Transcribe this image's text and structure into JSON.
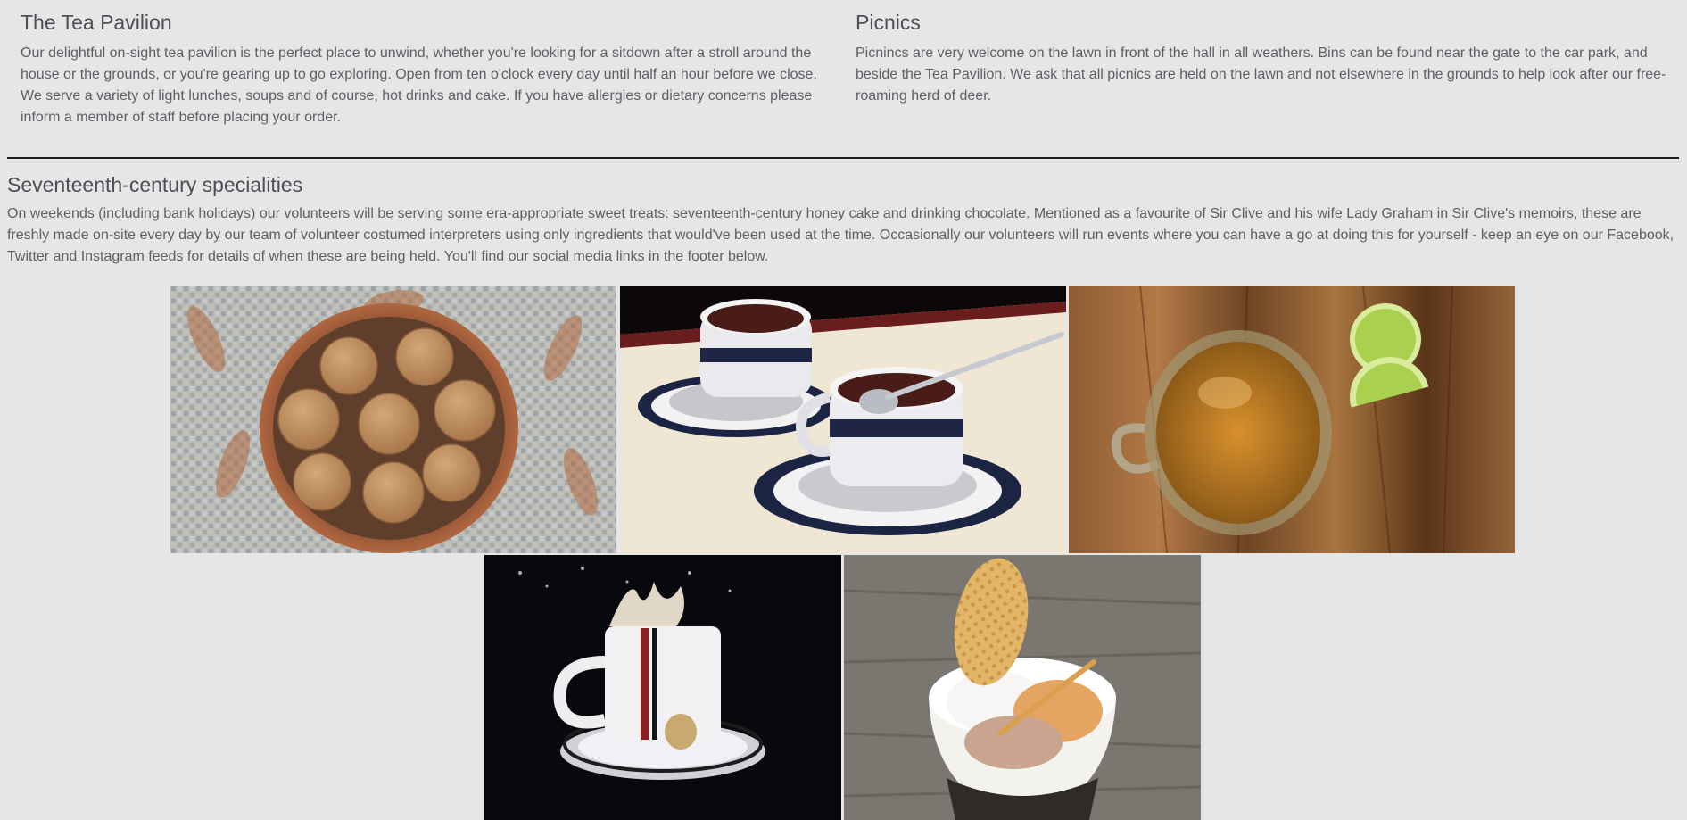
{
  "tea_pavilion": {
    "title": "The Tea Pavilion",
    "body": "Our delightful on-sight tea pavilion is the perfect place to unwind, whether you're looking for a sitdown after a stroll around the house or the grounds, or you're gearing up to go exploring. Open from ten o'clock every day until half an hour before we close. We serve a variety of light lunches, soups and of course, hot drinks and cake. If you have allergies or dietary concerns please inform a member of staff before placing your order."
  },
  "picnics": {
    "title": "Picnics",
    "body": "Picnincs are very welcome on the lawn in front of the hall in all weathers. Bins can be found near the gate to the car park, and beside the Tea Pavilion. We ask that all picnics are held on the lawn and not elsewhere in the grounds to help look after our free-roaming herd of deer."
  },
  "specialities": {
    "title": "Seventeenth-century specialities",
    "body": "On weekends (including bank holidays) our volunteers will be serving some era-appropriate sweet treats: seventeenth-century honey cake and drinking chocolate. Mentioned as a favourite of Sir Clive and his wife Lady Graham in Sir Clive's memoirs, these are freshly made on-site every day by our team of volunteer costumed interpreters using only ingredients that would've been used at the time. Occasionally our volunteers will run events where you can have a go at doing this for yourself - keep an eye on our Facebook, Twitter and Instagram feeds for details of when these are being held. You'll find our social media links in the footer below."
  },
  "gallery": {
    "photos": [
      {
        "subject": "honey-cakes-bowl"
      },
      {
        "subject": "drinking-chocolate-cups"
      },
      {
        "subject": "tea-glass-with-lime"
      },
      {
        "subject": "splashing-cup"
      },
      {
        "subject": "ice-cream-wafer"
      }
    ]
  },
  "colors": {
    "background": "#e5e6e5",
    "heading": "#4e4e58",
    "body_text": "#5e5e66",
    "rule": "#1d1d1f"
  }
}
